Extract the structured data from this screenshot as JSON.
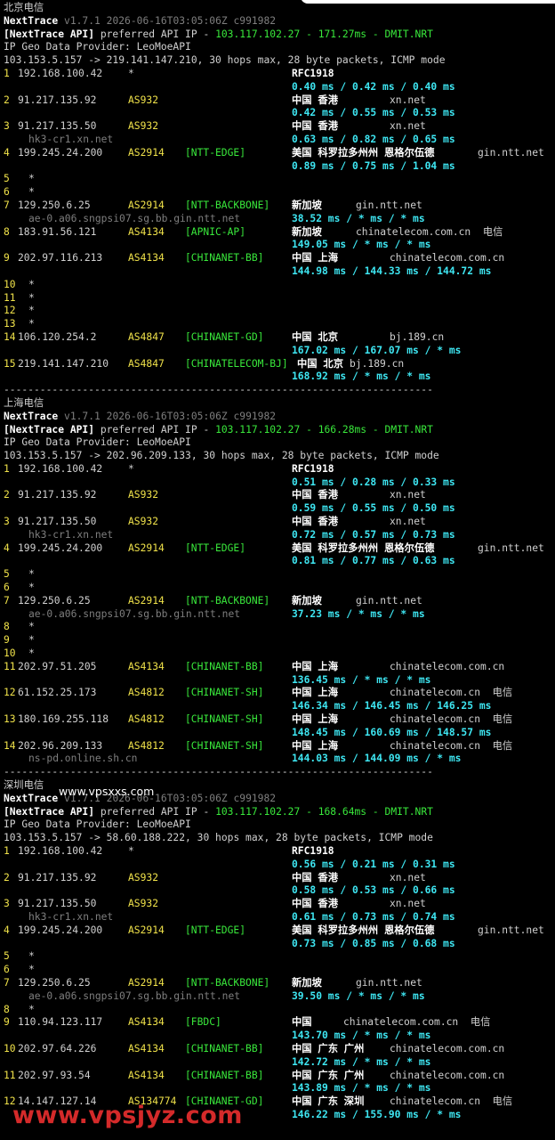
{
  "colors": {
    "background": "#000000",
    "text": "#d0d0d0",
    "asn": "#f0e24a",
    "tag": "#39e83b",
    "latency": "#3ee6f2",
    "hostname": "#7e7e7e",
    "watermark": "#d42a2a"
  },
  "watermark_mid": "www.vpsxxs.com",
  "watermark_bottom": "www.vpsjyz.com",
  "sections": [
    {
      "title": "北京电信",
      "app": "NextTrace",
      "version": "v1.7.1 2026-06-16T03:05:06Z c991982",
      "api_prefix": "[NextTrace API]",
      "api_text": " preferred API IP - ",
      "api_ip": "103.117.102.27",
      "api_ms": "171.27ms",
      "api_node": "DMIT.NRT",
      "geo": "IP Geo Data Provider: LeoMoeAPI",
      "route": "103.153.5.157 -> 219.141.147.210, 30 hops max, 28 byte packets, ICMP mode",
      "hops": [
        {
          "n": "1",
          "ip": "192.168.100.42",
          "asn": "*",
          "tag": "",
          "geo": "RFC1918",
          "extra": "",
          "lat": "0.40 ms / 0.42 ms / 0.40 ms",
          "host": ""
        },
        {
          "n": "2",
          "ip": "91.217.135.92",
          "asn": "AS932",
          "tag": "",
          "geo": "中国 香港",
          "extra": "xn.net",
          "lat": "0.42 ms / 0.55 ms / 0.53 ms",
          "host": ""
        },
        {
          "n": "3",
          "ip": "91.217.135.50",
          "asn": "AS932",
          "tag": "",
          "geo": "中国 香港",
          "extra": "xn.net",
          "lat": "0.63 ms / 0.82 ms / 0.65 ms",
          "host": "hk3-cr1.xn.net"
        },
        {
          "n": "4",
          "ip": "199.245.24.200",
          "asn": "AS2914",
          "tag": "[NTT-EDGE]",
          "geo": "美国 科罗拉多州州 恩格尔伍德",
          "extra": "gin.ntt.net",
          "lat": "0.89 ms / 0.75 ms / 1.04 ms",
          "host": ""
        },
        {
          "n": "5",
          "ip": "*"
        },
        {
          "n": "6",
          "ip": "*"
        },
        {
          "n": "7",
          "ip": "129.250.6.25",
          "asn": "AS2914",
          "tag": "[NTT-BACKBONE]",
          "geo": "新加坡",
          "extra": "gin.ntt.net",
          "lat": "38.52 ms / * ms / * ms",
          "host": "ae-0.a06.sngpsi07.sg.bb.gin.ntt.net"
        },
        {
          "n": "8",
          "ip": "183.91.56.121",
          "asn": "AS4134",
          "tag": "[APNIC-AP]",
          "geo": "新加坡",
          "extra": "chinatelecom.com.cn  电信",
          "lat": "149.05 ms / * ms / * ms",
          "host": ""
        },
        {
          "n": "9",
          "ip": "202.97.116.213",
          "asn": "AS4134",
          "tag": "[CHINANET-BB]",
          "geo": "中国 上海",
          "extra": "chinatelecom.com.cn",
          "lat": "144.98 ms / 144.33 ms / 144.72 ms",
          "host": ""
        },
        {
          "n": "10",
          "ip": "*"
        },
        {
          "n": "11",
          "ip": "*"
        },
        {
          "n": "12",
          "ip": "*"
        },
        {
          "n": "13",
          "ip": "*"
        },
        {
          "n": "14",
          "ip": "106.120.254.2",
          "asn": "AS4847",
          "tag": "[CHINANET-GD]",
          "geo": "中国 北京",
          "extra": "bj.189.cn",
          "lat": "167.02 ms / 167.07 ms / * ms",
          "host": ""
        },
        {
          "n": "15",
          "ip": "219.141.147.210",
          "asn": "AS4847",
          "tag": "[CHINATELECOM-BJ]",
          "geo": "中国 北京",
          "extra": "bj.189.cn",
          "lat": "168.92 ms / * ms / * ms",
          "host": ""
        }
      ],
      "divider": "-----------------------------------------------------------------------"
    },
    {
      "title": "上海电信",
      "app": "NextTrace",
      "version": "v1.7.1 2026-06-16T03:05:06Z c991982",
      "api_prefix": "[NextTrace API]",
      "api_text": " preferred API IP - ",
      "api_ip": "103.117.102.27",
      "api_ms": "166.28ms",
      "api_node": "DMIT.NRT",
      "geo": "IP Geo Data Provider: LeoMoeAPI",
      "route": "103.153.5.157 -> 202.96.209.133, 30 hops max, 28 byte packets, ICMP mode",
      "hops": [
        {
          "n": "1",
          "ip": "192.168.100.42",
          "asn": "*",
          "tag": "",
          "geo": "RFC1918",
          "extra": "",
          "lat": "0.51 ms / 0.28 ms / 0.33 ms",
          "host": ""
        },
        {
          "n": "2",
          "ip": "91.217.135.92",
          "asn": "AS932",
          "tag": "",
          "geo": "中国 香港",
          "extra": "xn.net",
          "lat": "0.59 ms / 0.55 ms / 0.50 ms",
          "host": ""
        },
        {
          "n": "3",
          "ip": "91.217.135.50",
          "asn": "AS932",
          "tag": "",
          "geo": "中国 香港",
          "extra": "xn.net",
          "lat": "0.72 ms / 0.57 ms / 0.73 ms",
          "host": "hk3-cr1.xn.net"
        },
        {
          "n": "4",
          "ip": "199.245.24.200",
          "asn": "AS2914",
          "tag": "[NTT-EDGE]",
          "geo": "美国 科罗拉多州州 恩格尔伍德",
          "extra": "gin.ntt.net",
          "lat": "0.81 ms / 0.77 ms / 0.63 ms",
          "host": ""
        },
        {
          "n": "5",
          "ip": "*"
        },
        {
          "n": "6",
          "ip": "*"
        },
        {
          "n": "7",
          "ip": "129.250.6.25",
          "asn": "AS2914",
          "tag": "[NTT-BACKBONE]",
          "geo": "新加坡",
          "extra": "gin.ntt.net",
          "lat": "37.23 ms / * ms / * ms",
          "host": "ae-0.a06.sngpsi07.sg.bb.gin.ntt.net"
        },
        {
          "n": "8",
          "ip": "*"
        },
        {
          "n": "9",
          "ip": "*"
        },
        {
          "n": "10",
          "ip": "*"
        },
        {
          "n": "11",
          "ip": "202.97.51.205",
          "asn": "AS4134",
          "tag": "[CHINANET-BB]",
          "geo": "中国 上海",
          "extra": "chinatelecom.com.cn",
          "lat": "136.45 ms / * ms / * ms",
          "host": ""
        },
        {
          "n": "12",
          "ip": "61.152.25.173",
          "asn": "AS4812",
          "tag": "[CHINANET-SH]",
          "geo": "中国 上海",
          "extra": "chinatelecom.cn  电信",
          "lat": "146.34 ms / 146.45 ms / 146.25 ms",
          "host": ""
        },
        {
          "n": "13",
          "ip": "180.169.255.118",
          "asn": "AS4812",
          "tag": "[CHINANET-SH]",
          "geo": "中国 上海",
          "extra": "chinatelecom.cn  电信",
          "lat": "148.45 ms / 160.69 ms / 148.57 ms",
          "host": ""
        },
        {
          "n": "14",
          "ip": "202.96.209.133",
          "asn": "AS4812",
          "tag": "[CHINANET-SH]",
          "geo": "中国 上海",
          "extra": "chinatelecom.cn  电信",
          "lat": "144.03 ms / 144.09 ms / * ms",
          "host": "ns-pd.online.sh.cn"
        }
      ],
      "divider": "-----------------------------------------------------------------------"
    },
    {
      "title": "深圳电信",
      "app": "NextTrace",
      "version": "v1.7.1 2026-06-16T03:05:06Z c991982",
      "api_prefix": "[NextTrace API]",
      "api_text": " preferred API IP - ",
      "api_ip": "103.117.102.27",
      "api_ms": "168.64ms",
      "api_node": "DMIT.NRT",
      "geo": "IP Geo Data Provider: LeoMoeAPI",
      "route": "103.153.5.157 -> 58.60.188.222, 30 hops max, 28 byte packets, ICMP mode",
      "hops": [
        {
          "n": "1",
          "ip": "192.168.100.42",
          "asn": "*",
          "tag": "",
          "geo": "RFC1918",
          "extra": "",
          "lat": "0.56 ms / 0.21 ms / 0.31 ms",
          "host": ""
        },
        {
          "n": "2",
          "ip": "91.217.135.92",
          "asn": "AS932",
          "tag": "",
          "geo": "中国 香港",
          "extra": "xn.net",
          "lat": "0.58 ms / 0.53 ms / 0.66 ms",
          "host": ""
        },
        {
          "n": "3",
          "ip": "91.217.135.50",
          "asn": "AS932",
          "tag": "",
          "geo": "中国 香港",
          "extra": "xn.net",
          "lat": "0.61 ms / 0.73 ms / 0.74 ms",
          "host": "hk3-cr1.xn.net"
        },
        {
          "n": "4",
          "ip": "199.245.24.200",
          "asn": "AS2914",
          "tag": "[NTT-EDGE]",
          "geo": "美国 科罗拉多州州 恩格尔伍德",
          "extra": "gin.ntt.net",
          "lat": "0.73 ms / 0.85 ms / 0.68 ms",
          "host": ""
        },
        {
          "n": "5",
          "ip": "*"
        },
        {
          "n": "6",
          "ip": "*"
        },
        {
          "n": "7",
          "ip": "129.250.6.25",
          "asn": "AS2914",
          "tag": "[NTT-BACKBONE]",
          "geo": "新加坡",
          "extra": "gin.ntt.net",
          "lat": "39.50 ms / * ms / * ms",
          "host": "ae-0.a06.sngpsi07.sg.bb.gin.ntt.net"
        },
        {
          "n": "8",
          "ip": "*"
        },
        {
          "n": "9",
          "ip": "110.94.123.117",
          "asn": "AS4134",
          "tag": "[FBDC]",
          "geo": "中国",
          "extra": "chinatelecom.com.cn  电信",
          "lat": "143.70 ms / * ms / * ms",
          "host": ""
        },
        {
          "n": "10",
          "ip": "202.97.64.226",
          "asn": "AS4134",
          "tag": "[CHINANET-BB]",
          "geo": "中国 广东 广州",
          "extra": "chinatelecom.com.cn",
          "lat": "142.72 ms / * ms / * ms",
          "host": ""
        },
        {
          "n": "11",
          "ip": "202.97.93.54",
          "asn": "AS4134",
          "tag": "[CHINANET-BB]",
          "geo": "中国 广东 广州",
          "extra": "chinatelecom.com.cn",
          "lat": "143.89 ms / * ms / * ms",
          "host": ""
        },
        {
          "n": "12",
          "ip": "14.147.127.14",
          "asn": "AS134774",
          "tag": "[CHINANET-GD]",
          "geo": "中国 广东 深圳",
          "extra": "chinatelecom.cn  电信",
          "lat": "146.22 ms / 155.90 ms / * ms",
          "host": ""
        }
      ],
      "divider": ""
    }
  ]
}
